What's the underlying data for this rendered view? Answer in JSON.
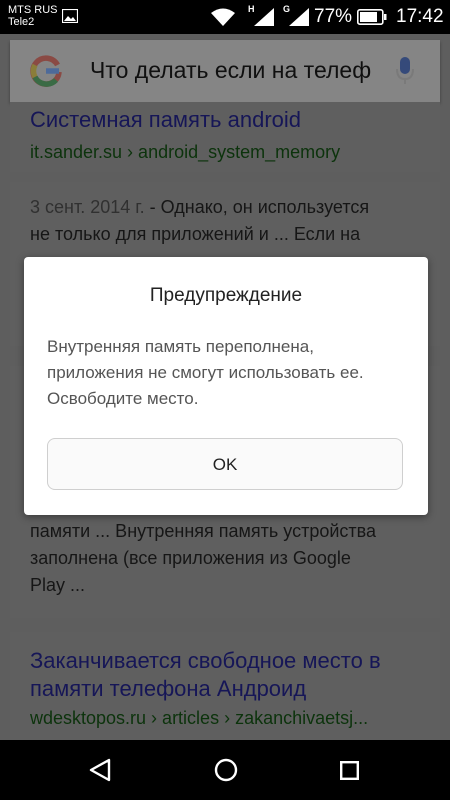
{
  "status_bar": {
    "carrier1": "MTS RUS",
    "carrier2": "Tele2",
    "net1": "H",
    "net2": "G",
    "battery": "77%",
    "time": "17:42"
  },
  "search": {
    "query": "Что делать если на телеф"
  },
  "results": [
    {
      "title": "Системная память android",
      "url": "it.sander.su › android_system_memory"
    },
    {
      "date": "3 сент. 2014 г.",
      "snippet_lines": [
        "- Однако, он используется",
        "не только для приложений и ... Если на"
      ]
    },
    {
      "snippet_lines": [
        "памяти ... Внутренняя память устройства",
        "заполнена (все приложения из Google",
        "Play  ..."
      ]
    },
    {
      "title_lines": [
        "Заканчивается свободное место в",
        "памяти телефона Андроид"
      ],
      "url": "wdesktopos.ru › articles › zakanchivaetsj..."
    }
  ],
  "dialog": {
    "title": "Предупреждение",
    "message_lines": [
      "Внутренняя память переполнена,",
      "приложения не смогут использовать ее.",
      "Освободите место."
    ],
    "ok_label": "OK"
  },
  "colors": {
    "google_blue": "#4285F4",
    "google_red": "#EA4335",
    "google_yellow": "#FBBC05",
    "google_green": "#34A853"
  }
}
